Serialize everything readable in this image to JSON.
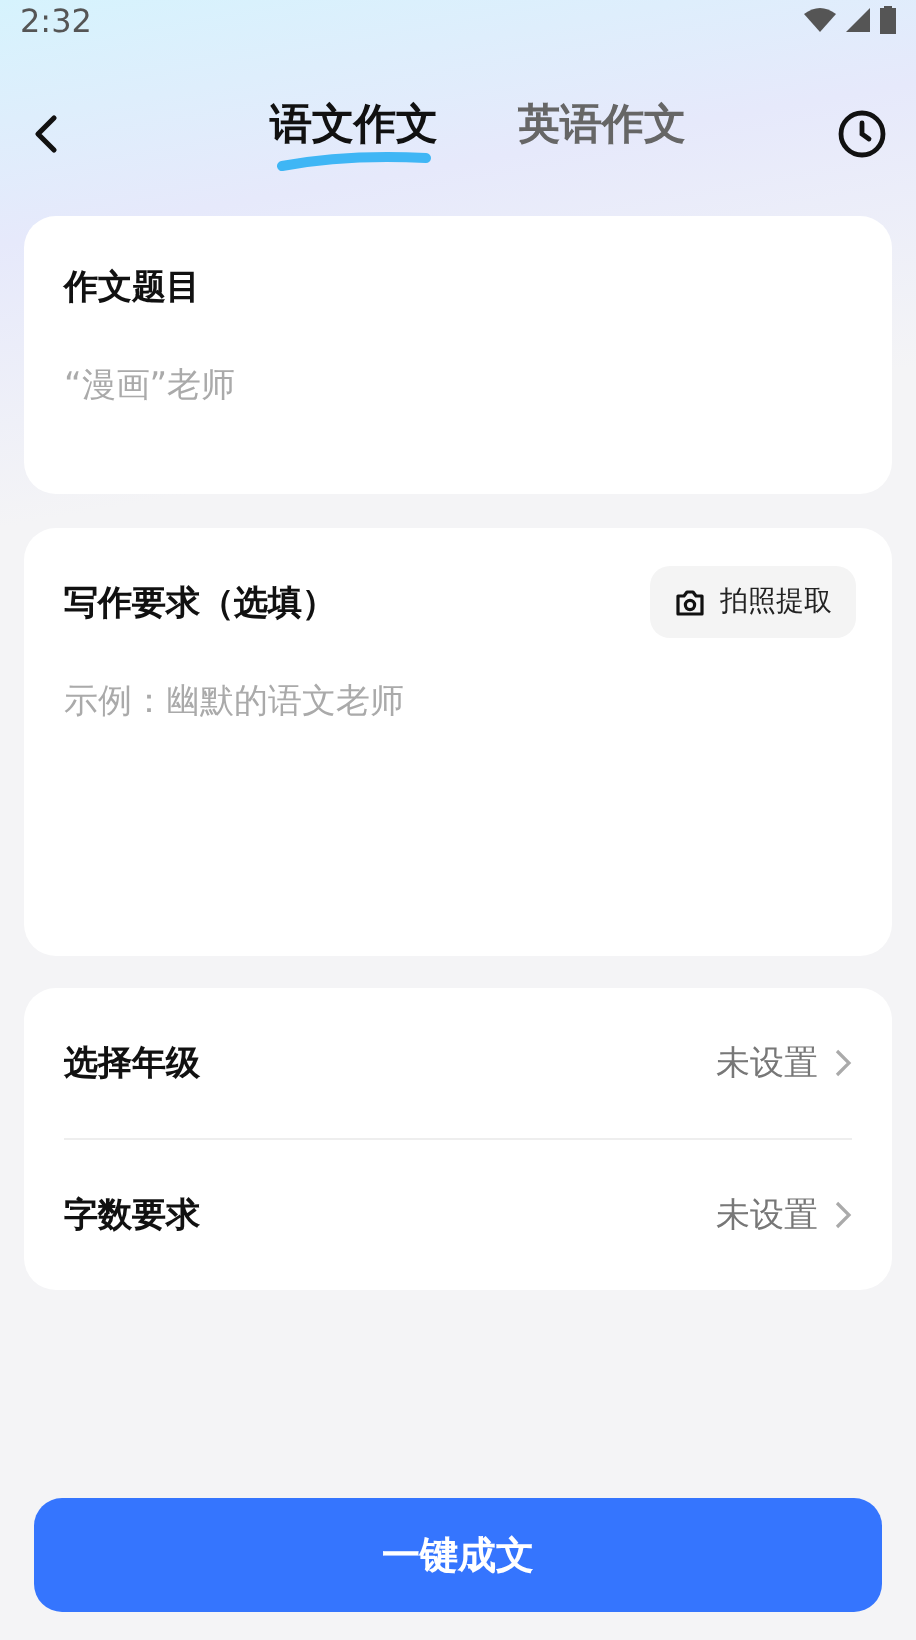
{
  "status_bar": {
    "time": "2:32"
  },
  "tabs": [
    {
      "label": "语文作文",
      "selected": true
    },
    {
      "label": "英语作文",
      "selected": false
    }
  ],
  "topic": {
    "title": "作文题目",
    "placeholder": "“漫画”老师"
  },
  "requirements": {
    "title": "写作要求（选填）",
    "photo_button": "拍照提取",
    "placeholder": "示例：幽默的语文老师"
  },
  "settings": [
    {
      "label": "选择年级",
      "value": "未设置"
    },
    {
      "label": "字数要求",
      "value": "未设置"
    }
  ],
  "submit_button": "一键成文"
}
